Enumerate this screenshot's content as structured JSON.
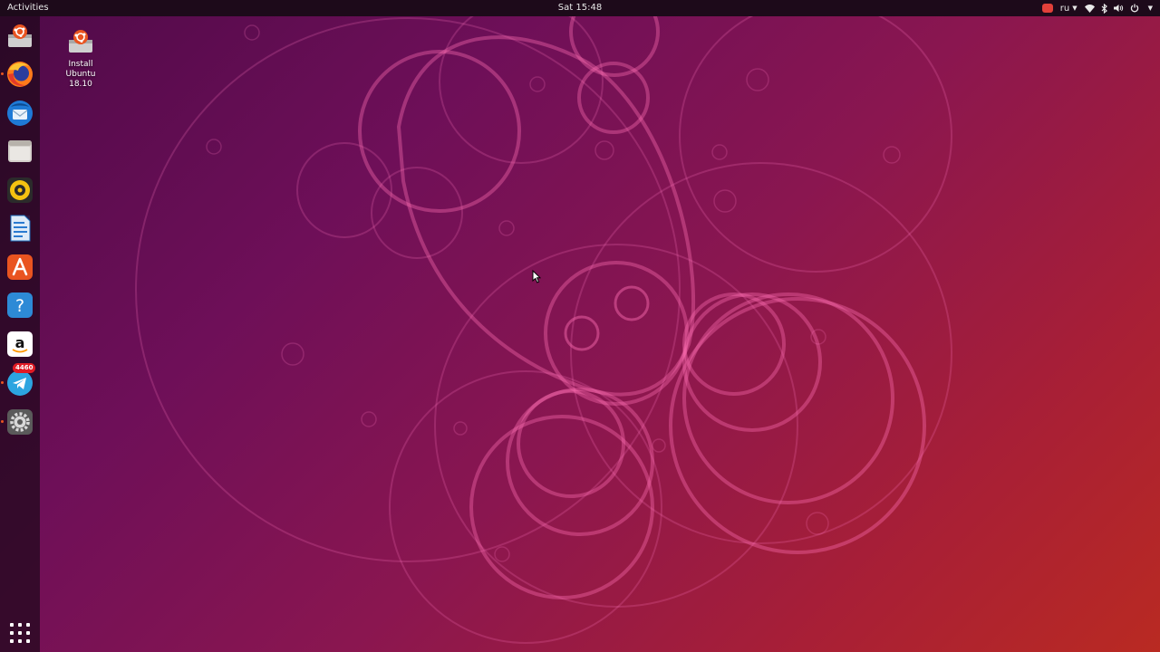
{
  "topbar": {
    "activities_label": "Activities",
    "clock": "Sat 15:48",
    "language": "ru",
    "icons": [
      "red-indicator-icon",
      "wifi-icon",
      "bluetooth-icon",
      "volume-icon",
      "power-icon"
    ]
  },
  "dock": {
    "items": [
      {
        "name": "install-ubuntu",
        "icon": "installer-icon"
      },
      {
        "name": "firefox",
        "icon": "firefox-icon",
        "running": true
      },
      {
        "name": "thunderbird",
        "icon": "thunderbird-icon"
      },
      {
        "name": "files",
        "icon": "files-icon"
      },
      {
        "name": "rhythmbox",
        "icon": "rhythmbox-icon"
      },
      {
        "name": "libreoffice-writer",
        "icon": "writer-icon"
      },
      {
        "name": "ubuntu-software",
        "icon": "software-icon"
      },
      {
        "name": "help",
        "icon": "help-icon"
      },
      {
        "name": "amazon",
        "icon": "amazon-icon"
      },
      {
        "name": "telegram",
        "icon": "telegram-icon",
        "running": true,
        "badge": "4460"
      },
      {
        "name": "settings",
        "icon": "settings-icon",
        "running": true
      }
    ],
    "show_apps_icon": "app-grid-icon"
  },
  "desktop": {
    "icons": [
      {
        "label": "Install\nUbuntu\n18.10",
        "icon": "installer-icon"
      }
    ]
  },
  "colors": {
    "topbar_bg": "#1d0a1a",
    "accent": "#e95420",
    "badge": "#e01b24"
  }
}
